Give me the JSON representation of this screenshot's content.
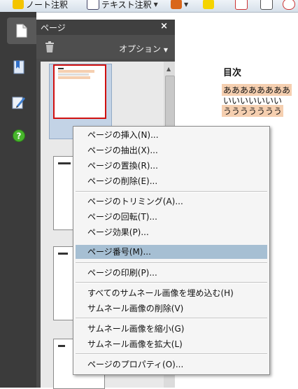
{
  "toolbar": {
    "item1": "ノート注釈",
    "item2": "テキスト注釈"
  },
  "panel": {
    "title": "ページ",
    "close": "×",
    "options": "オプション"
  },
  "document": {
    "toc_title": "目次",
    "lines": [
      "ああああああああ",
      "いいいいいいい",
      "ううううううう"
    ],
    "highlight_color": "#f5cfb0"
  },
  "menu": {
    "items": [
      "ページの挿入(N)...",
      "ページの抽出(X)...",
      "ページの置換(R)...",
      "ページの削除(E)...",
      "ページのトリミング(A)...",
      "ページの回転(T)...",
      "ページ効果(P)...",
      "ページ番号(M)...",
      "ページの印刷(P)...",
      "すべてのサムネール画像を埋め込む(H)",
      "サムネール画像の削除(V)",
      "サムネール画像を縮小(G)",
      "サムネール画像を拡大(L)",
      "ページのプロパティ(O)..."
    ],
    "highlighted_item": "ページ番号(M)..."
  },
  "colors": {
    "sidebar": "#3b3b3b",
    "panel": "#4a4a4a",
    "menu_highlight": "#a6bfd3",
    "selection_border": "#d01010"
  }
}
